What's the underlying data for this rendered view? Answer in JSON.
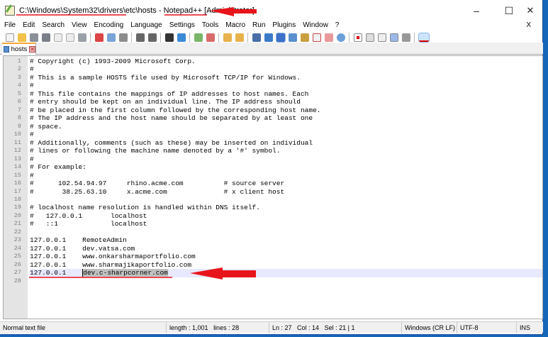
{
  "window": {
    "title_path": "C:\\Windows\\System32\\drivers\\etc\\hosts",
    "title_sep": " - Notepad++ ",
    "title_admin": "[Administrator]",
    "minimize": "–",
    "maximize": "☐",
    "close": "✕"
  },
  "menu": {
    "items": [
      "File",
      "Edit",
      "Search",
      "View",
      "Encoding",
      "Language",
      "Settings",
      "Tools",
      "Macro",
      "Run",
      "Plugins",
      "Window",
      "?"
    ],
    "close": "X"
  },
  "tab": {
    "label": "hosts",
    "close": "✕"
  },
  "editor": {
    "line_numbers": [
      "1",
      "2",
      "3",
      "4",
      "5",
      "6",
      "7",
      "8",
      "9",
      "10",
      "11",
      "12",
      "13",
      "14",
      "15",
      "16",
      "17",
      "18",
      "19",
      "20",
      "21",
      "22",
      "23",
      "24",
      "25",
      "26",
      "27",
      "28"
    ],
    "lines": [
      "# Copyright (c) 1993-2009 Microsoft Corp.",
      "#",
      "# This is a sample HOSTS file used by Microsoft TCP/IP for Windows.",
      "#",
      "# This file contains the mappings of IP addresses to host names. Each",
      "# entry should be kept on an individual line. The IP address should",
      "# be placed in the first column followed by the corresponding host name.",
      "# The IP address and the host name should be separated by at least one",
      "# space.",
      "#",
      "# Additionally, comments (such as these) may be inserted on individual",
      "# lines or following the machine name denoted by a '#' symbol.",
      "#",
      "# For example:",
      "#",
      "#      102.54.94.97     rhino.acme.com          # source server",
      "#       38.25.63.10     x.acme.com              # x client host",
      "",
      "# localhost name resolution is handled within DNS itself.",
      "#   127.0.0.1       localhost",
      "#   ::1             localhost",
      "",
      "127.0.0.1    RemoteAdmin",
      "127.0.0.1    dev.vatsa.com",
      "127.0.0.1    www.onkarsharmaportfolio.com",
      "127.0.0.1    www.sharmajikaportfolio.com",
      "",
      ""
    ],
    "line27_prefix": "127.0.0.1    ",
    "line27_selected": "dev.c-sharpcorner.com",
    "current_line": 27
  },
  "status": {
    "type": "Normal text file",
    "length": "length : 1,001",
    "lines": "lines : 28",
    "ln": "Ln : 27",
    "col": "Col : 14",
    "sel": "Sel : 21 | 1",
    "eol": "Windows (CR LF)",
    "encoding": "UTF-8",
    "mode": "INS"
  },
  "colors": {
    "annotation": "#e8141b",
    "tab_accent": "#f7a83a",
    "current_line": "#e8e8ff"
  }
}
